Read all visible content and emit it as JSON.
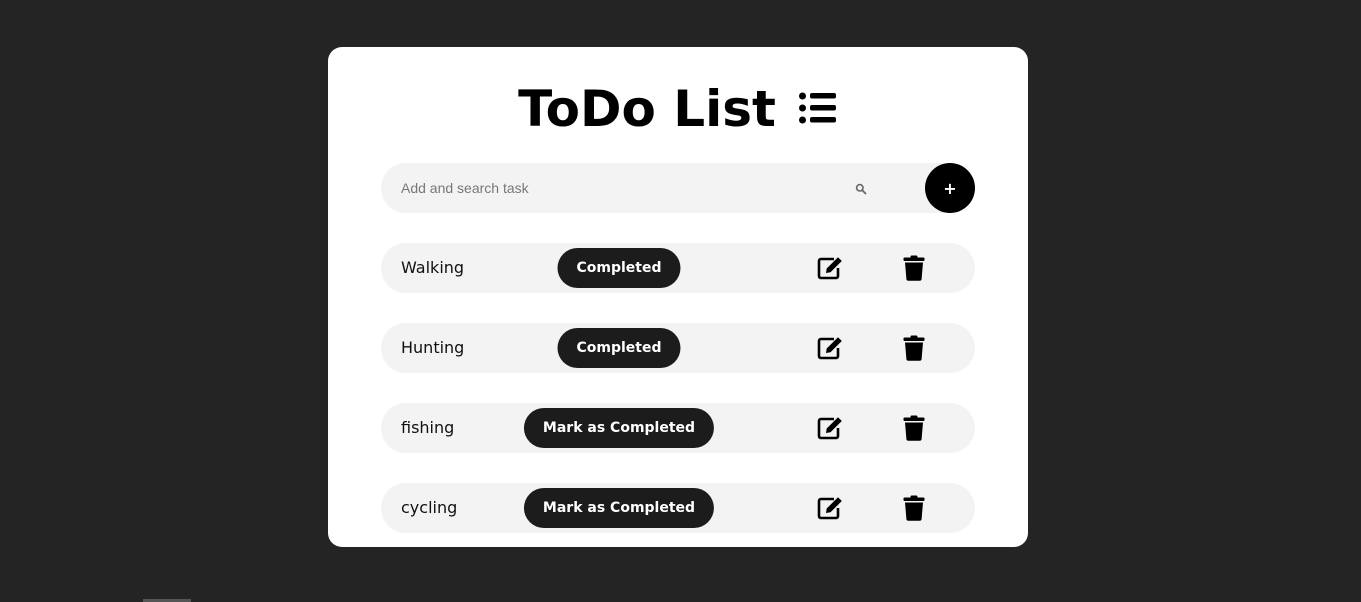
{
  "app": {
    "title": "ToDo List",
    "title_icon": "list-icon"
  },
  "search": {
    "placeholder": "Add and search task",
    "value": "",
    "search_icon": "search-icon",
    "add_label": "+"
  },
  "tasks": [
    {
      "name": "Walking",
      "status_label": "Completed",
      "edit_icon": "edit-icon",
      "delete_icon": "trash-icon"
    },
    {
      "name": "Hunting",
      "status_label": "Completed",
      "edit_icon": "edit-icon",
      "delete_icon": "trash-icon"
    },
    {
      "name": "fishing",
      "status_label": "Mark as Completed",
      "edit_icon": "edit-icon",
      "delete_icon": "trash-icon"
    },
    {
      "name": "cycling",
      "status_label": "Mark as Completed",
      "edit_icon": "edit-icon",
      "delete_icon": "trash-icon"
    }
  ],
  "colors": {
    "page_background": "#242424",
    "card_background": "#ffffff",
    "row_background": "#f3f3f3",
    "button_background": "#1c1c1c",
    "accent": "#000000"
  }
}
